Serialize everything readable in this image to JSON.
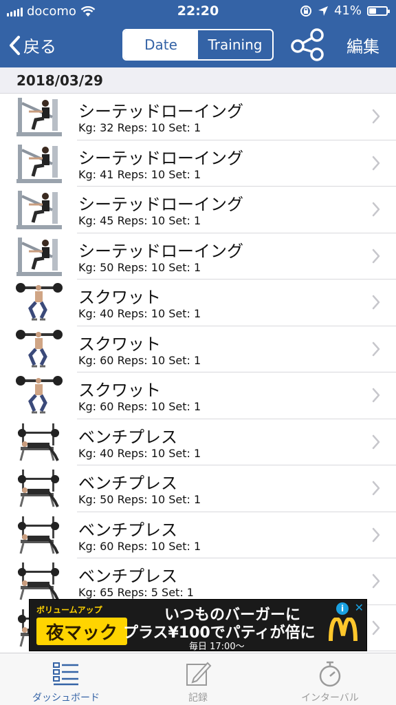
{
  "status": {
    "carrier": "docomo",
    "time": "22:20",
    "battery_percent": "41%",
    "battery_level": 0.41
  },
  "nav": {
    "back_label": "戻る",
    "segments": [
      "Date",
      "Training"
    ],
    "selected_segment": 0,
    "edit_label": "編集"
  },
  "section": {
    "date": "2018/03/29"
  },
  "list": [
    {
      "name": "シーテッドローイング",
      "detail": "Kg: 32 Reps: 10 Set: 1",
      "icon": "seated-row-machine-icon"
    },
    {
      "name": "シーテッドローイング",
      "detail": "Kg: 41 Reps: 10 Set: 1",
      "icon": "seated-row-machine-icon"
    },
    {
      "name": "シーテッドローイング",
      "detail": "Kg: 45 Reps: 10 Set: 1",
      "icon": "seated-row-machine-icon"
    },
    {
      "name": "シーテッドローイング",
      "detail": "Kg: 50 Reps: 10 Set: 1",
      "icon": "seated-row-machine-icon"
    },
    {
      "name": "スクワット",
      "detail": "Kg: 40 Reps: 10 Set: 1",
      "icon": "squat-icon"
    },
    {
      "name": "スクワット",
      "detail": "Kg: 60 Reps: 10 Set: 1",
      "icon": "squat-icon"
    },
    {
      "name": "スクワット",
      "detail": "Kg: 60 Reps: 10 Set: 1",
      "icon": "squat-icon"
    },
    {
      "name": "ベンチプレス",
      "detail": "Kg: 40 Reps: 10 Set: 1",
      "icon": "bench-press-icon"
    },
    {
      "name": "ベンチプレス",
      "detail": "Kg: 50 Reps: 10 Set: 1",
      "icon": "bench-press-icon"
    },
    {
      "name": "ベンチプレス",
      "detail": "Kg: 60 Reps: 10 Set: 1",
      "icon": "bench-press-icon"
    },
    {
      "name": "ベンチプレス",
      "detail": "Kg: 65 Reps: 5 Set: 1",
      "icon": "bench-press-icon"
    },
    {
      "name": "",
      "detail": "",
      "icon": "bench-press-icon"
    }
  ],
  "ad": {
    "badge": "ボリュームアップ",
    "headline": "夜マック",
    "line1": "いつものバーガーに",
    "line2": "プラス¥100でパティが倍に",
    "line3": "毎日 17:00〜",
    "info": "i",
    "close": "✕"
  },
  "tabs": [
    {
      "label": "ダッシュボード",
      "icon": "dashboard-list-icon",
      "active": true
    },
    {
      "label": "記録",
      "icon": "edit-note-icon",
      "active": false
    },
    {
      "label": "インターバル",
      "icon": "stopwatch-icon",
      "active": false
    }
  ],
  "colors": {
    "nav_bar": "#3463a6",
    "active_tab": "#3463a6",
    "inactive_tab": "#9a9a9a",
    "section_bg": "#efeff4"
  }
}
